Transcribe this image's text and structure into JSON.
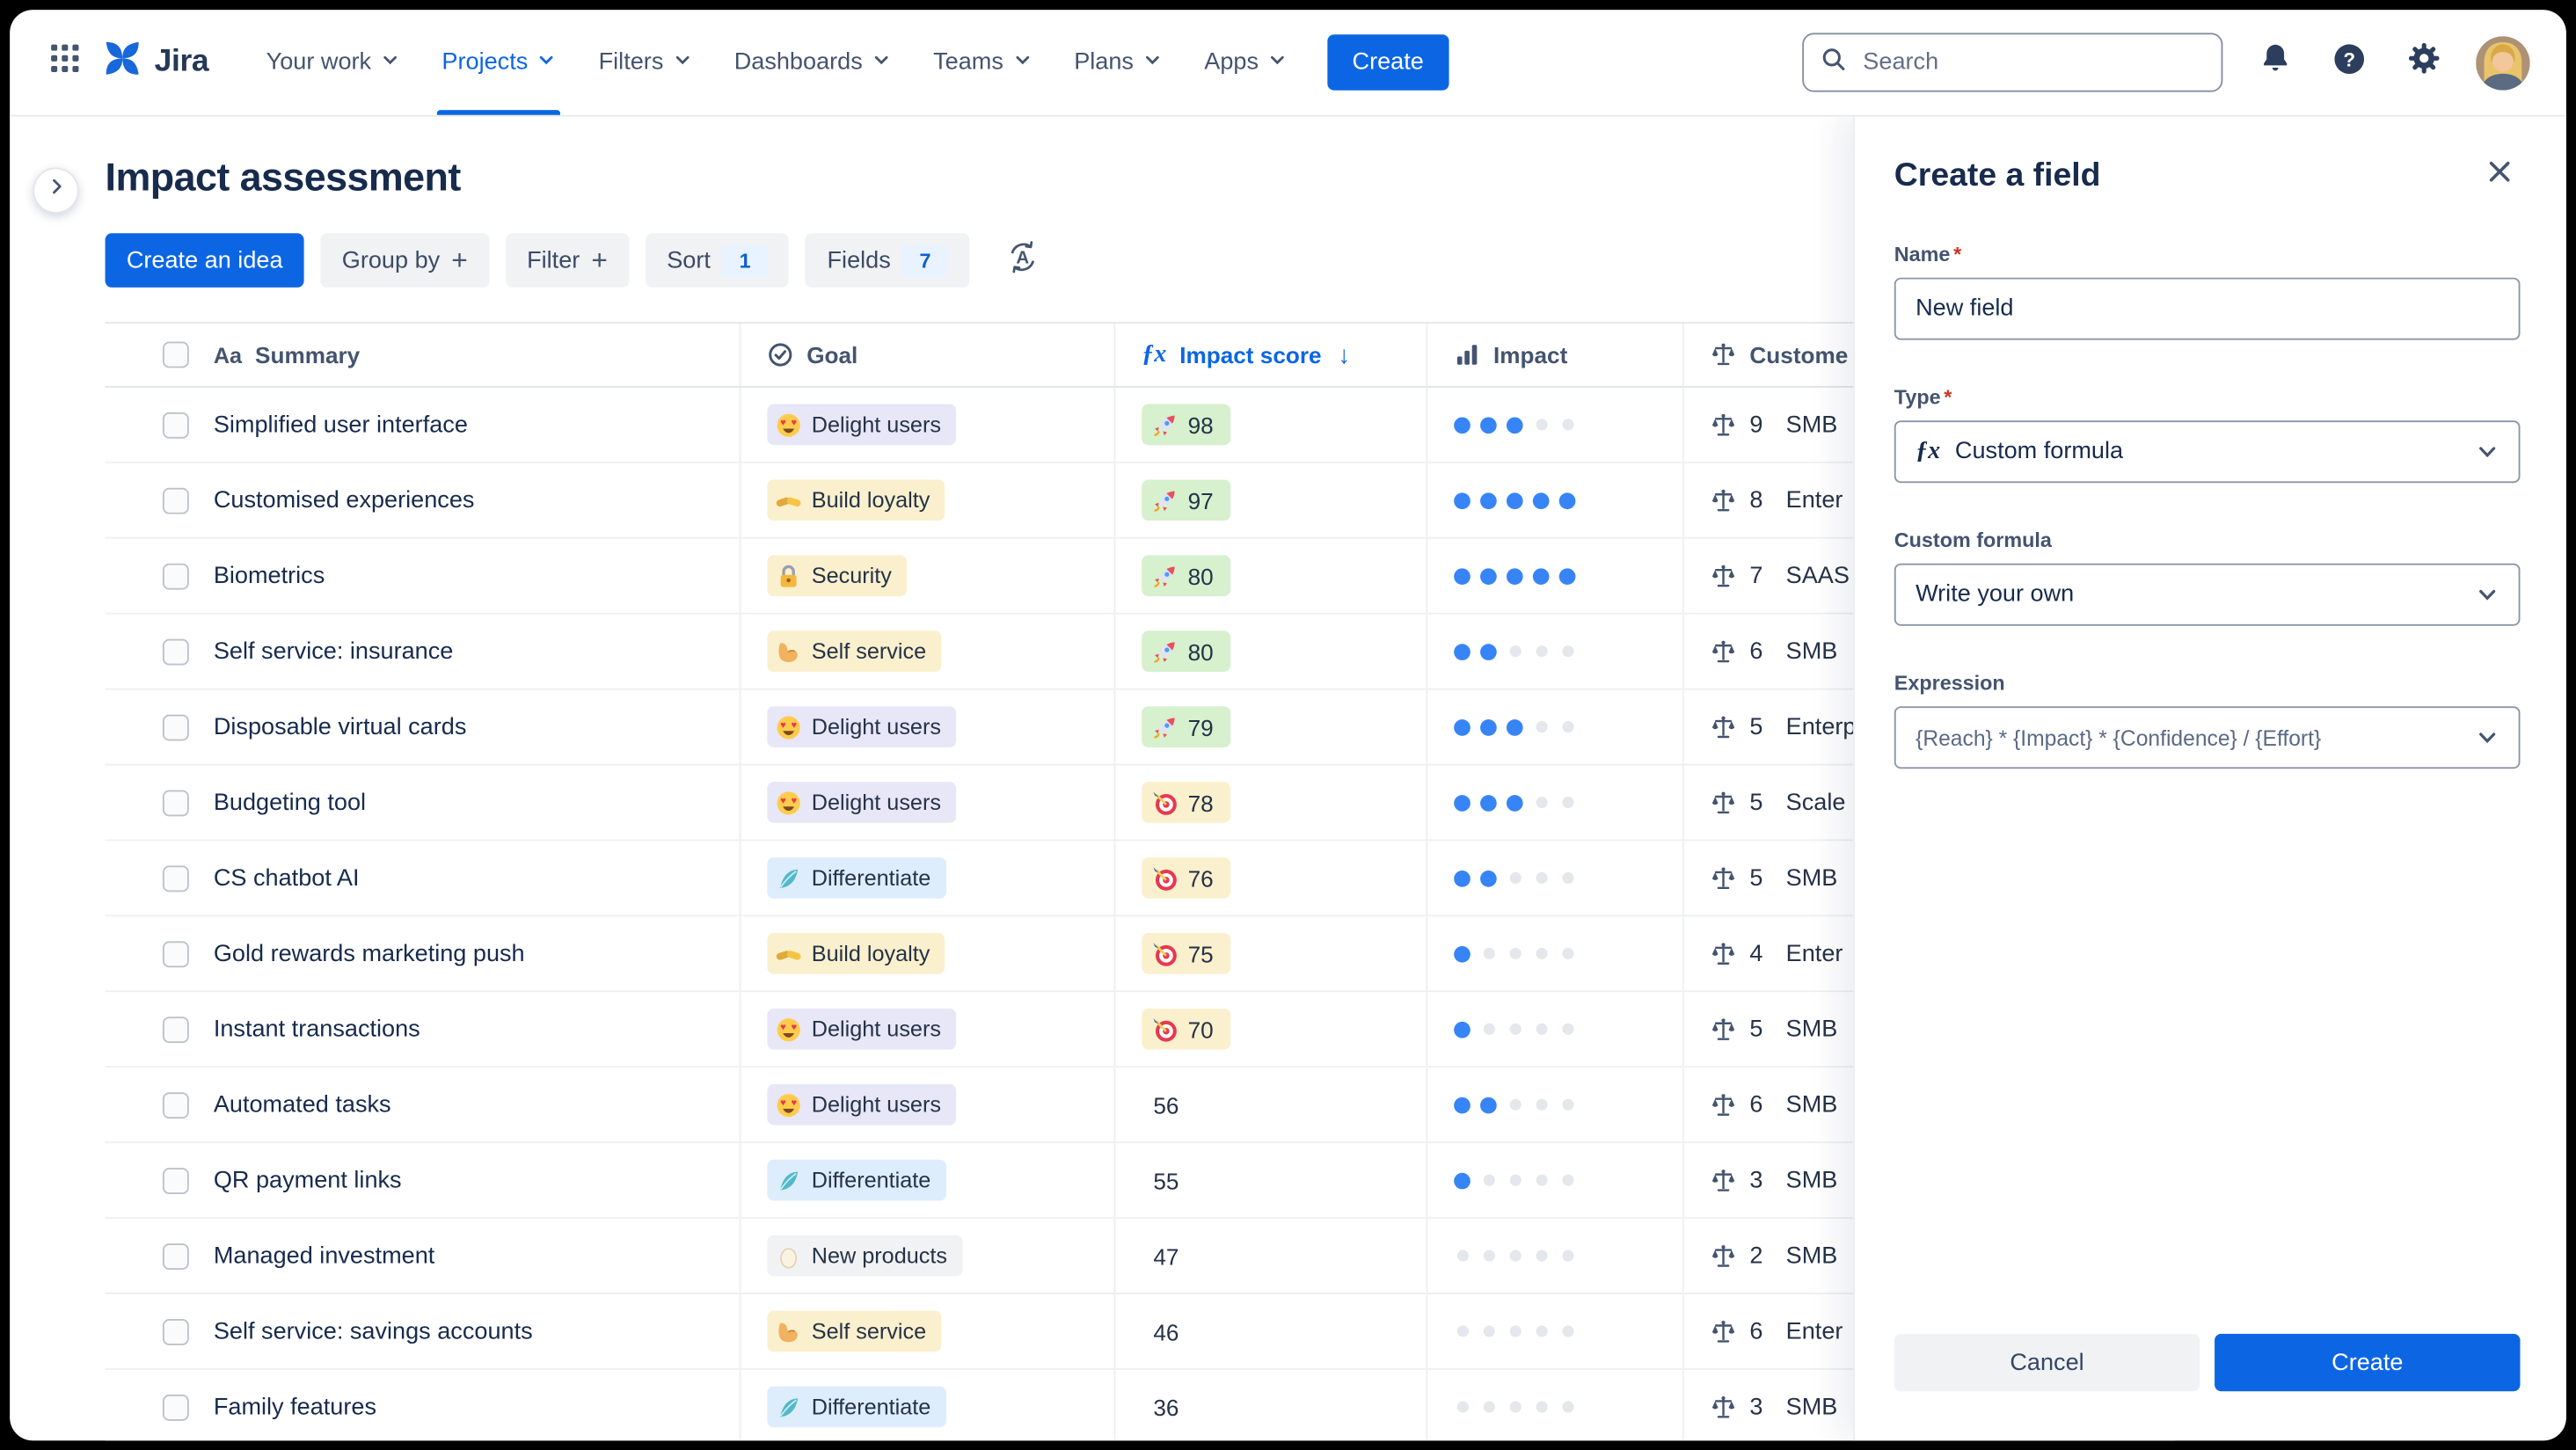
{
  "colors": {
    "accent": "#0C66E4",
    "green_pill": "#D7F0CE",
    "yellow_pill": "#FAF0CD",
    "impact_dot": "#3784F6"
  },
  "navbar": {
    "logo": "Jira",
    "items": [
      {
        "label": "Your work"
      },
      {
        "label": "Projects",
        "active": true
      },
      {
        "label": "Filters"
      },
      {
        "label": "Dashboards"
      },
      {
        "label": "Teams"
      },
      {
        "label": "Plans"
      },
      {
        "label": "Apps"
      }
    ],
    "create_button": "Create",
    "search": {
      "placeholder": "Search",
      "icon": "search-icon"
    },
    "right_icons": [
      "notifications-icon",
      "help-icon",
      "settings-icon",
      "avatar"
    ]
  },
  "page": {
    "title": "Impact assessment"
  },
  "toolbar": {
    "create_idea_button": "Create an idea",
    "group_by_button": "Group by",
    "filter_button": "Filter",
    "sort_button": "Sort",
    "sort_count": "1",
    "fields_button": "Fields",
    "fields_count": "7",
    "plus_icon": "+",
    "rank_icon": "sort-alphabetical-icon"
  },
  "table": {
    "columns": [
      {
        "label": "Summary",
        "icon_label": "Aa",
        "icon": "text-type-icon"
      },
      {
        "label": "Goal",
        "icon": "goal-icon"
      },
      {
        "label": "Impact score",
        "icon_label": "ƒx",
        "icon": "formula-icon",
        "sorted": "desc",
        "sort_arrow": "↓"
      },
      {
        "label": "Impact",
        "icon": "bar-chart-icon"
      },
      {
        "label": "Custome",
        "icon": "scales-icon"
      }
    ],
    "rows": [
      {
        "summary": "Simplified user interface",
        "goal": {
          "label": "Delight users",
          "icon": "heart-eyes-icon",
          "color": "purple"
        },
        "score": {
          "value": "98",
          "icon": "rocket-icon",
          "color": "green"
        },
        "impact": 3,
        "customer": {
          "count": "9",
          "segment": "SMB"
        }
      },
      {
        "summary": "Customised experiences",
        "goal": {
          "label": "Build loyalty",
          "icon": "handshake-icon",
          "color": "yellow"
        },
        "score": {
          "value": "97",
          "icon": "rocket-icon",
          "color": "green"
        },
        "impact": 5,
        "customer": {
          "count": "8",
          "segment": "Enter"
        }
      },
      {
        "summary": "Biometrics",
        "goal": {
          "label": "Security",
          "icon": "lock-icon",
          "color": "yellow"
        },
        "score": {
          "value": "80",
          "icon": "rocket-icon",
          "color": "green"
        },
        "impact": 5,
        "customer": {
          "count": "7",
          "segment": "SAAS"
        }
      },
      {
        "summary": "Self service: insurance",
        "goal": {
          "label": "Self service",
          "icon": "flex-bicep-icon",
          "color": "yellow"
        },
        "score": {
          "value": "80",
          "icon": "rocket-icon",
          "color": "green"
        },
        "impact": 2,
        "customer": {
          "count": "6",
          "segment": "SMB"
        }
      },
      {
        "summary": "Disposable virtual cards",
        "goal": {
          "label": "Delight users",
          "icon": "heart-eyes-icon",
          "color": "purple"
        },
        "score": {
          "value": "79",
          "icon": "rocket-icon",
          "color": "green"
        },
        "impact": 3,
        "customer": {
          "count": "5",
          "segment": "Enterp"
        }
      },
      {
        "summary": "Budgeting tool",
        "goal": {
          "label": "Delight users",
          "icon": "heart-eyes-icon",
          "color": "purple"
        },
        "score": {
          "value": "78",
          "icon": "dart-icon",
          "color": "yellow"
        },
        "impact": 3,
        "customer": {
          "count": "5",
          "segment": "Scale"
        }
      },
      {
        "summary": "CS chatbot AI",
        "goal": {
          "label": "Differentiate",
          "icon": "feather-icon",
          "color": "blue"
        },
        "score": {
          "value": "76",
          "icon": "dart-icon",
          "color": "yellow"
        },
        "impact": 2,
        "customer": {
          "count": "5",
          "segment": "SMB"
        }
      },
      {
        "summary": "Gold rewards marketing push",
        "goal": {
          "label": "Build loyalty",
          "icon": "handshake-icon",
          "color": "yellow"
        },
        "score": {
          "value": "75",
          "icon": "dart-icon",
          "color": "yellow"
        },
        "impact": 1,
        "customer": {
          "count": "4",
          "segment": "Enter"
        }
      },
      {
        "summary": "Instant transactions",
        "goal": {
          "label": "Delight users",
          "icon": "heart-eyes-icon",
          "color": "purple"
        },
        "score": {
          "value": "70",
          "icon": "dart-icon",
          "color": "yellow"
        },
        "impact": 1,
        "customer": {
          "count": "5",
          "segment": "SMB"
        }
      },
      {
        "summary": "Automated tasks",
        "goal": {
          "label": "Delight users",
          "icon": "heart-eyes-icon",
          "color": "purple"
        },
        "score": {
          "value": "56",
          "icon": null,
          "color": "none"
        },
        "impact": 2,
        "customer": {
          "count": "6",
          "segment": "SMB"
        }
      },
      {
        "summary": "QR payment links",
        "goal": {
          "label": "Differentiate",
          "icon": "feather-icon",
          "color": "blue"
        },
        "score": {
          "value": "55",
          "icon": null,
          "color": "none"
        },
        "impact": 1,
        "customer": {
          "count": "3",
          "segment": "SMB"
        }
      },
      {
        "summary": "Managed investment",
        "goal": {
          "label": "New products",
          "icon": "egg-icon",
          "color": "gray"
        },
        "score": {
          "value": "47",
          "icon": null,
          "color": "none"
        },
        "impact": 0,
        "customer": {
          "count": "2",
          "segment": "SMB"
        }
      },
      {
        "summary": "Self service: savings accounts",
        "goal": {
          "label": "Self service",
          "icon": "flex-bicep-icon",
          "color": "yellow"
        },
        "score": {
          "value": "46",
          "icon": null,
          "color": "none"
        },
        "impact": 0,
        "customer": {
          "count": "6",
          "segment": "Enter"
        }
      },
      {
        "summary": "Family features",
        "goal": {
          "label": "Differentiate",
          "icon": "feather-icon",
          "color": "blue"
        },
        "score": {
          "value": "36",
          "icon": null,
          "color": "none"
        },
        "impact": 0,
        "customer": {
          "count": "3",
          "segment": "SMB"
        }
      }
    ]
  },
  "panel": {
    "title": "Create a field",
    "close_icon": "close-icon",
    "name_label": "Name",
    "required_marker": "*",
    "name_value": "New field",
    "type_label": "Type",
    "type_icon_label": "ƒx",
    "type_value": "Custom formula",
    "custom_formula_label": "Custom formula",
    "custom_formula_value": "Write your own",
    "expression_label": "Expression",
    "expression_value": "{Reach} * {Impact} * {Confidence} / {Effort}",
    "cancel_button": "Cancel",
    "create_button": "Create"
  }
}
